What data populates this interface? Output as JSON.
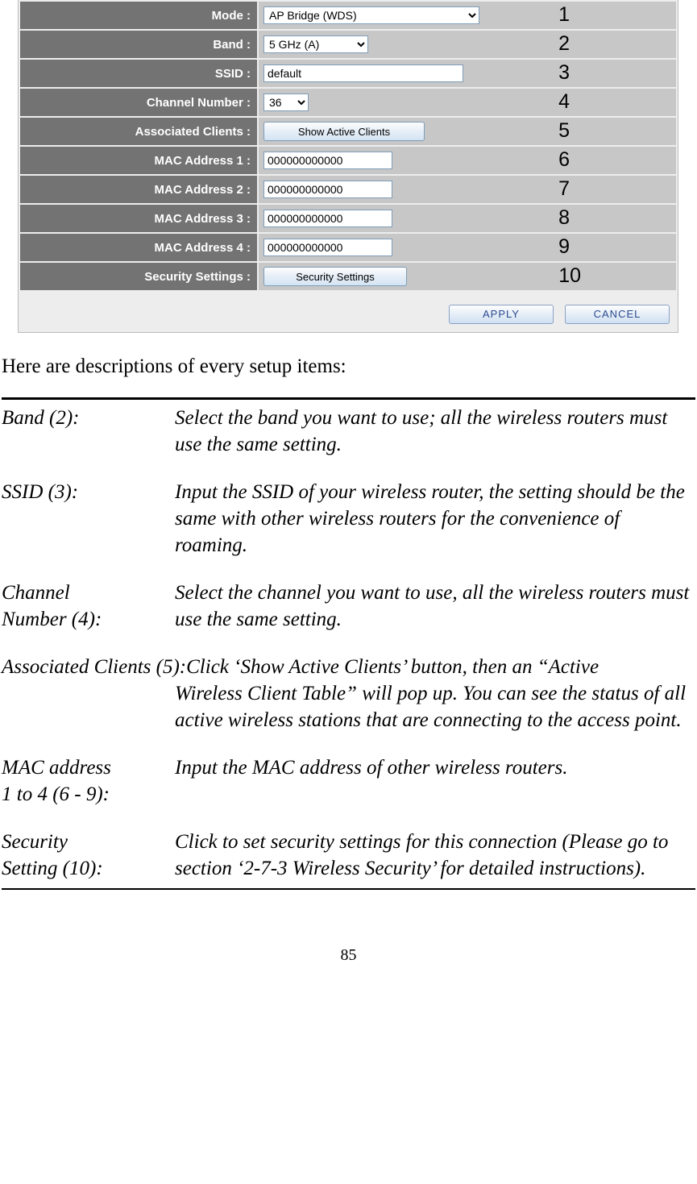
{
  "config": {
    "rows": [
      {
        "label": "Mode :",
        "num": "1"
      },
      {
        "label": "Band :",
        "num": "2"
      },
      {
        "label": "SSID :",
        "num": "3"
      },
      {
        "label": "Channel Number :",
        "num": "4"
      },
      {
        "label": "Associated Clients :",
        "num": "5"
      },
      {
        "label": "MAC Address 1 :",
        "num": "6"
      },
      {
        "label": "MAC Address 2 :",
        "num": "7"
      },
      {
        "label": "MAC Address 3 :",
        "num": "8"
      },
      {
        "label": "MAC Address 4 :",
        "num": "9"
      },
      {
        "label": "Security Settings :",
        "num": "10"
      }
    ],
    "mode_value": "AP Bridge (WDS)",
    "band_value": "5 GHz (A)",
    "ssid_value": "default",
    "channel_value": "36",
    "mac_value": "000000000000",
    "show_btn": "Show Active Clients",
    "sec_btn": "Security Settings",
    "apply": "APPLY",
    "cancel": "CANCEL"
  },
  "intro": "Here are descriptions of every setup items:",
  "desc": {
    "band_term": "Band (2):",
    "band_def": "Select the band you want to use; all the wireless routers must use the same setting.",
    "ssid_term": "SSID (3):",
    "ssid_def": "Input the SSID of your wireless router, the setting should be the same with other wireless routers for the convenience of roaming.",
    "chan_term1": "Channel",
    "chan_term2": "Number (4):",
    "chan_def": "Select the channel you want to use, all the wireless routers must use the same setting.",
    "assoc_first": "Associated Clients (5):Click ‘Show Active Clients’ button, then an “Active",
    "assoc_rest": "Wireless Client Table” will pop up. You can see the status of all active wireless stations that are connecting to the access point.",
    "mac_term1": "MAC address",
    "mac_term2": "1 to 4 (6 - 9):",
    "mac_def": "Input the MAC address of other wireless routers.",
    "sec_term1": "Security",
    "sec_term2": "Setting (10):",
    "sec_def": "Click to set security settings for this connection (Please go to section ‘2-7-3 Wireless Security’ for detailed instructions)."
  },
  "page": "85"
}
